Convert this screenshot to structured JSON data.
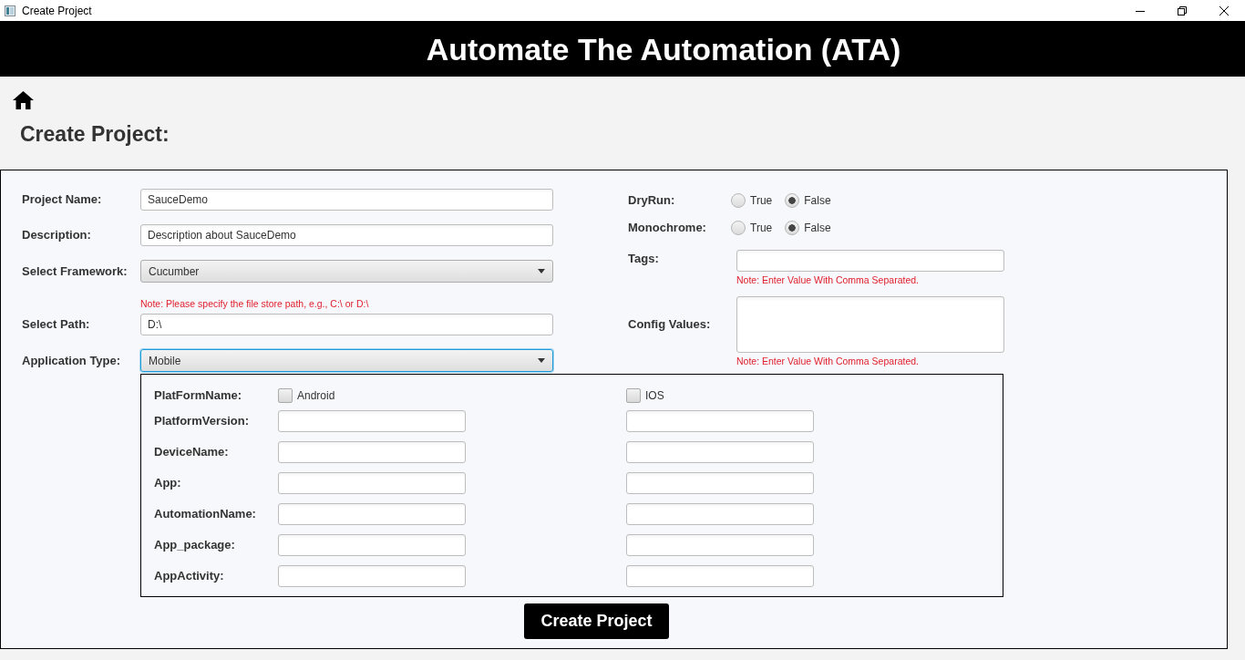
{
  "window": {
    "title": "Create Project"
  },
  "header": {
    "title": "Automate The Automation (ATA)"
  },
  "page_title": "Create Project:",
  "form": {
    "fields": [
      {
        "kind": "text",
        "label": "Project Name:",
        "value": "SauceDemo"
      },
      {
        "kind": "text",
        "label": "Description:",
        "value": "Description about SauceDemo"
      },
      {
        "kind": "select",
        "label": "Select Framework:",
        "value": "Cucumber",
        "focused": false
      },
      {
        "kind": "note",
        "text": "Note: Please specify the file store path, e.g., C:\\ or D:\\"
      },
      {
        "kind": "text",
        "label": "Select Path:",
        "value": "D:\\"
      },
      {
        "kind": "select",
        "label": "Application Type:",
        "value": "Mobile",
        "focused": true
      }
    ],
    "options": [
      {
        "kind": "radio",
        "label": "DryRun:",
        "choices": [
          {
            "label": "True",
            "selected": false
          },
          {
            "label": "False",
            "selected": true
          }
        ]
      },
      {
        "kind": "radio",
        "label": "Monochrome:",
        "choices": [
          {
            "label": "True",
            "selected": false
          },
          {
            "label": "False",
            "selected": true
          }
        ]
      },
      {
        "kind": "text",
        "label": "Tags:",
        "note": "Note: Enter Value With Comma Separated."
      },
      {
        "kind": "textarea",
        "label": "Config Values:",
        "note": "Note: Enter Value With Comma Separated."
      }
    ]
  },
  "mobile": {
    "platform_label": "PlatFormName:",
    "platforms": [
      {
        "label": "Android",
        "checked": false
      },
      {
        "label": "IOS",
        "checked": false
      }
    ],
    "rows": [
      {
        "label": "PlatformVersion:"
      },
      {
        "label": "DeviceName:"
      },
      {
        "label": "App:"
      },
      {
        "label": "AutomationName:"
      },
      {
        "label": "App_package:"
      },
      {
        "label": "AppActivity:"
      }
    ]
  },
  "submit": {
    "label": "Create Project"
  }
}
